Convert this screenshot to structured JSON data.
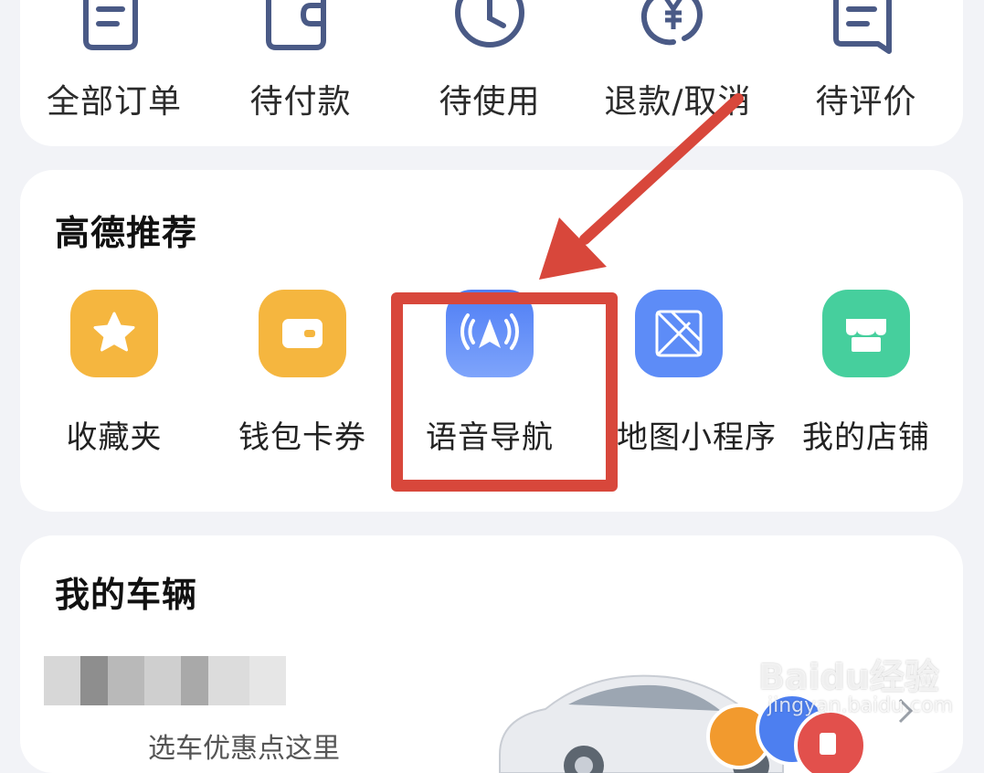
{
  "orders": {
    "items": [
      {
        "label": "全部订单",
        "icon": "order-list-icon"
      },
      {
        "label": "待付款",
        "icon": "wallet-icon"
      },
      {
        "label": "待使用",
        "icon": "clock-icon"
      },
      {
        "label": "退款/取消",
        "icon": "refund-yen-icon"
      },
      {
        "label": "待评价",
        "icon": "comment-icon"
      }
    ]
  },
  "recommend": {
    "title": "高德推荐",
    "items": [
      {
        "label": "收藏夹",
        "icon": "star-icon",
        "color": "#f5b63f"
      },
      {
        "label": "钱包卡券",
        "icon": "wallet-card-icon",
        "color": "#f5b63f"
      },
      {
        "label": "语音导航",
        "icon": "voice-navigation-icon",
        "color": "#5d8cf7"
      },
      {
        "label": "地图小程序",
        "icon": "mini-program-icon",
        "color": "#5d8cf7"
      },
      {
        "label": "我的店铺",
        "icon": "store-icon",
        "color": "#46cf9d"
      }
    ]
  },
  "vehicle": {
    "title": "我的车辆",
    "hint": "选车优惠点这里"
  },
  "watermark": {
    "main": "Baidu经验",
    "sub": "jingyan.baidu.com"
  },
  "colors": {
    "icon_stroke": "#4a5a86",
    "annotation_red": "#d8473b"
  }
}
